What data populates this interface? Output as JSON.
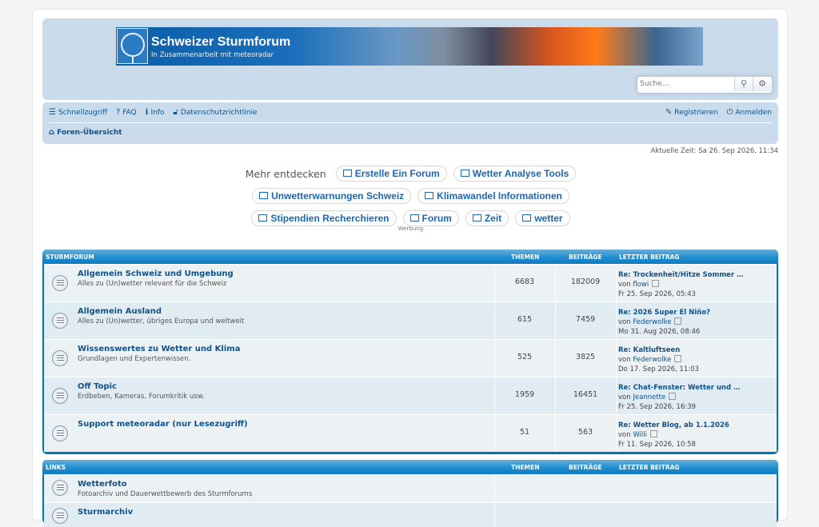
{
  "header": {
    "site_title": "Schweizer Sturmforum",
    "site_desc": "In Zusammenarbeit mit meteoradar",
    "search_placeholder": "Suche…"
  },
  "nav": {
    "left": [
      {
        "icon": "bars-icon",
        "label": "Schnellzugriff"
      },
      {
        "icon": "question-icon",
        "label": "FAQ"
      },
      {
        "icon": "info-icon",
        "label": "Info"
      },
      {
        "icon": "lock-icon",
        "label": "Datenschutzrichtlinie"
      }
    ],
    "right": [
      {
        "icon": "edit-icon",
        "label": "Registrieren"
      },
      {
        "icon": "power-icon",
        "label": "Anmelden"
      }
    ],
    "breadcrumb": "Foren-Übersicht"
  },
  "current_time": "Aktuelle Zeit: Sa 26. Sep 2026, 11:34",
  "discover": {
    "label": "Mehr entdecken",
    "rows": [
      [
        "Erstelle Ein Forum",
        "Wetter Analyse Tools"
      ],
      [
        "Unwetterwarnungen Schweiz",
        "Klimawandel Informationen"
      ],
      [
        "Stipendien Recherchieren",
        "Forum",
        "Zeit",
        "wetter"
      ]
    ],
    "ad_label": "Werbung"
  },
  "columns": {
    "topics": "THEMEN",
    "posts": "BEITRÄGE",
    "last": "LETZTER BEITRAG"
  },
  "categories": [
    {
      "name": "STURMFORUM",
      "forums": [
        {
          "title": "Allgemein Schweiz und Umgebung",
          "desc": "Alles zu (Un)wetter relevant für die Schweiz",
          "topics": "6683",
          "posts": "182009",
          "last_title": "Re: Trockenheit/Hitze Sommer …",
          "last_by": "von",
          "last_author": "flowi",
          "last_date": "Fr 25. Sep 2026, 05:43"
        },
        {
          "title": "Allgemein Ausland",
          "desc": "Alles zu (Un)wetter, übriges Europa und weltweit",
          "topics": "615",
          "posts": "7459",
          "last_title": "Re: 2026 Super El Niño?",
          "last_by": "von",
          "last_author": "Federwolke",
          "last_date": "Mo 31. Aug 2026, 08:46"
        },
        {
          "title": "Wissenswertes zu Wetter und Klima",
          "desc": "Grundlagen und Expertenwissen.",
          "topics": "525",
          "posts": "3825",
          "last_title": "Re: Kaltluftseen",
          "last_by": "von",
          "last_author": "Federwolke",
          "last_date": "Do 17. Sep 2026, 11:03"
        },
        {
          "title": "Off Topic",
          "desc": "Erdbeben, Kameras, Forumkritik usw.",
          "topics": "1959",
          "posts": "16451",
          "last_title": "Re: Chat-Fenster: Wetter und …",
          "last_by": "von",
          "last_author": "Jeannette",
          "last_date": "Fr 25. Sep 2026, 16:39"
        },
        {
          "title": "Support meteoradar (nur Lesezugriff)",
          "desc": "",
          "topics": "51",
          "posts": "563",
          "last_title": "Re: Wetter Blog, ab 1.1.2026",
          "last_by": "von",
          "last_author": "Willi",
          "last_date": "Fr 11. Sep 2026, 10:58"
        }
      ]
    },
    {
      "name": "LINKS",
      "forums": [
        {
          "title": "Wetterfoto",
          "desc": "Fotoarchiv und Dauerwettbewerb des Sturmforums",
          "topics": "",
          "posts": "",
          "last_title": "",
          "last_by": "",
          "last_author": "",
          "last_date": ""
        },
        {
          "title": "Sturmarchiv",
          "desc": "",
          "topics": "",
          "posts": "",
          "last_title": "",
          "last_by": "",
          "last_author": "",
          "last_date": ""
        }
      ]
    }
  ]
}
